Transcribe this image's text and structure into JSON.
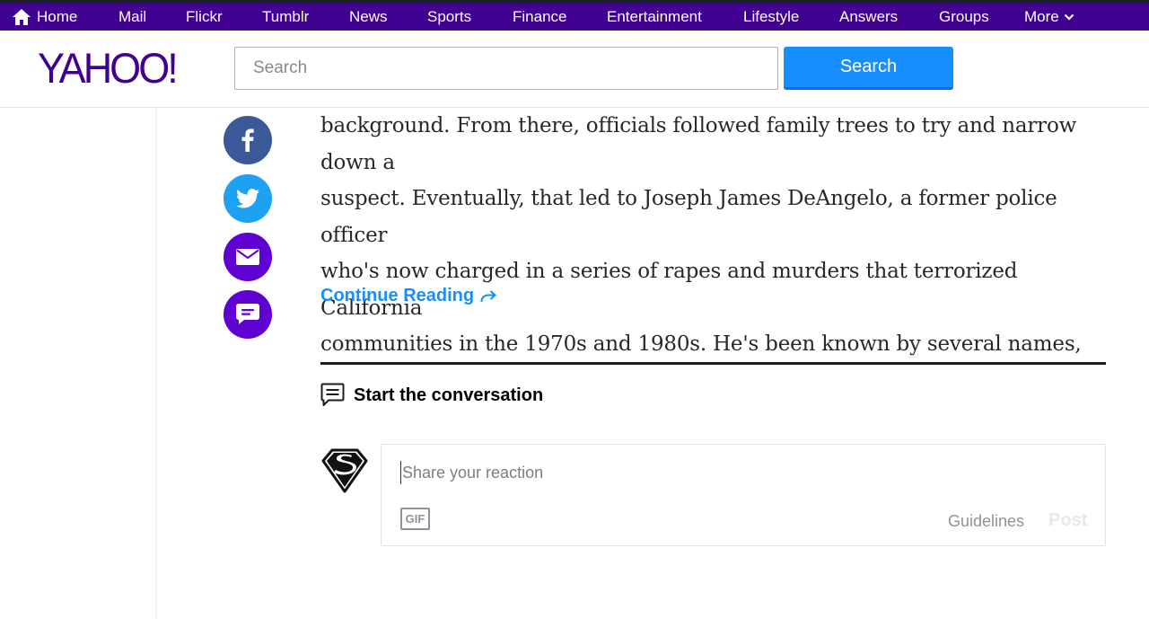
{
  "nav": {
    "home": "Home",
    "mail": "Mail",
    "flickr": "Flickr",
    "tumblr": "Tumblr",
    "news": "News",
    "sports": "Sports",
    "finance": "Finance",
    "entertainment": "Entertainment",
    "lifestyle": "Lifestyle",
    "answers": "Answers",
    "groups": "Groups",
    "more": "More"
  },
  "header": {
    "logo": "YAHOO!",
    "search_placeholder": "Search",
    "search_button": "Search"
  },
  "share": {
    "facebook_icon": "facebook-icon",
    "twitter_icon": "twitter-icon",
    "email_icon": "mail-icon",
    "comment_icon": "comment-icon"
  },
  "article": {
    "lines": [
      "background. From there, officials followed family trees to try and narrow down a",
      "suspect.  Eventually, that led to Joseph James DeAngelo, a former police officer",
      "who's now charged in a series of rapes and murders that terrorized California",
      "communities in the 1970s and 1980s. He's been known by several names,"
    ],
    "continue_label": "Continue Reading"
  },
  "conversation": {
    "title": "Start the conversation",
    "placeholder": "Share your reaction",
    "gif_label": "GIF",
    "guidelines_label": "Guidelines",
    "post_label": "Post"
  },
  "colors": {
    "nav_bg": "#400090",
    "brand": "#400090",
    "accent": "#188fff",
    "facebook": "#3b5998",
    "twitter": "#1da1f2",
    "mail": "#5f01d1",
    "comment": "#5f01d1"
  }
}
